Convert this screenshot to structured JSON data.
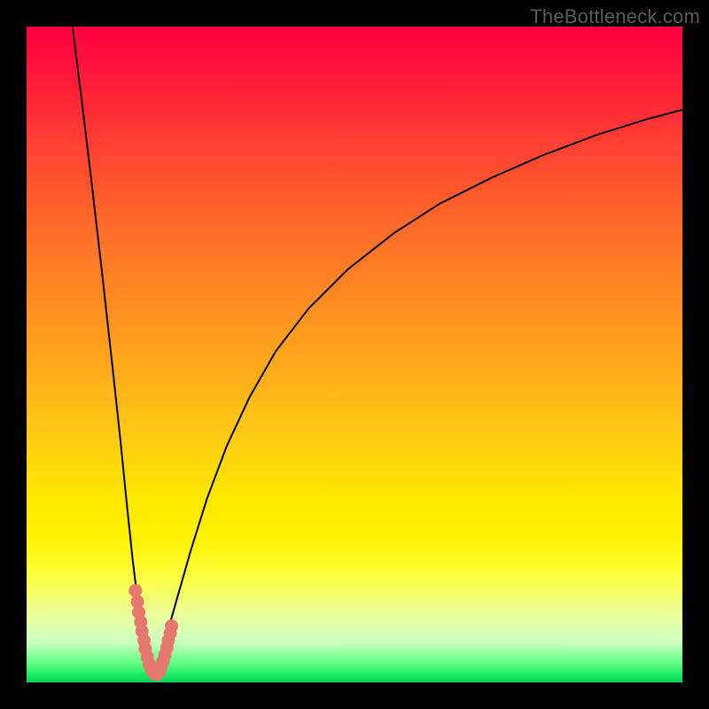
{
  "watermark": "TheBottleneck.com",
  "colors": {
    "frame": "#000000",
    "curve": "#000000",
    "marker_fill": "#e6776f",
    "marker_stroke": "#c95a52",
    "gradient_top": "#ff0040",
    "gradient_bottom": "#08d050"
  },
  "chart_data": {
    "type": "line",
    "title": "",
    "xlabel": "",
    "ylabel": "",
    "xlim": [
      0,
      100
    ],
    "ylim": [
      0,
      100
    ],
    "grid": false,
    "legend": false,
    "note": "Values estimated from pixel positions; axes unlabeled in source image. y is bottleneck-percentage-like (0 at bottom, 100 at top).",
    "series": [
      {
        "name": "left-branch",
        "x": [
          7.0,
          8.5,
          10.0,
          11.5,
          13.0,
          14.3,
          15.3,
          16.2,
          17.0,
          17.7,
          18.3,
          18.7,
          19.0
        ],
        "y": [
          100.0,
          88.0,
          75.5,
          62.5,
          49.0,
          37.0,
          27.0,
          18.5,
          12.0,
          7.5,
          4.3,
          2.3,
          1.0
        ]
      },
      {
        "name": "right-branch",
        "x": [
          19.0,
          20.0,
          21.3,
          23.0,
          25.0,
          27.5,
          30.5,
          34.0,
          38.0,
          43.0,
          49.0,
          56.0,
          63.0,
          71.0,
          79.0,
          87.0,
          95.0,
          100.0
        ],
        "y": [
          1.0,
          3.0,
          7.0,
          13.0,
          20.0,
          28.0,
          36.0,
          43.5,
          50.5,
          57.0,
          63.0,
          68.5,
          73.0,
          77.0,
          80.5,
          83.5,
          86.0,
          87.3
        ]
      }
    ],
    "markers": {
      "name": "bottom-cluster",
      "points": [
        {
          "x": 16.6,
          "y": 14.0
        },
        {
          "x": 16.9,
          "y": 12.3
        },
        {
          "x": 17.1,
          "y": 10.7
        },
        {
          "x": 17.4,
          "y": 9.2
        },
        {
          "x": 17.6,
          "y": 7.8
        },
        {
          "x": 17.9,
          "y": 6.4
        },
        {
          "x": 18.1,
          "y": 5.1
        },
        {
          "x": 18.4,
          "y": 3.9
        },
        {
          "x": 18.7,
          "y": 2.8
        },
        {
          "x": 19.0,
          "y": 2.0
        },
        {
          "x": 19.4,
          "y": 1.4
        },
        {
          "x": 19.8,
          "y": 1.2
        },
        {
          "x": 20.2,
          "y": 1.6
        },
        {
          "x": 20.5,
          "y": 2.3
        },
        {
          "x": 20.8,
          "y": 3.2
        },
        {
          "x": 21.1,
          "y": 4.2
        },
        {
          "x": 21.4,
          "y": 5.3
        },
        {
          "x": 21.6,
          "y": 6.4
        },
        {
          "x": 21.9,
          "y": 7.5
        },
        {
          "x": 22.1,
          "y": 8.6
        }
      ]
    }
  }
}
